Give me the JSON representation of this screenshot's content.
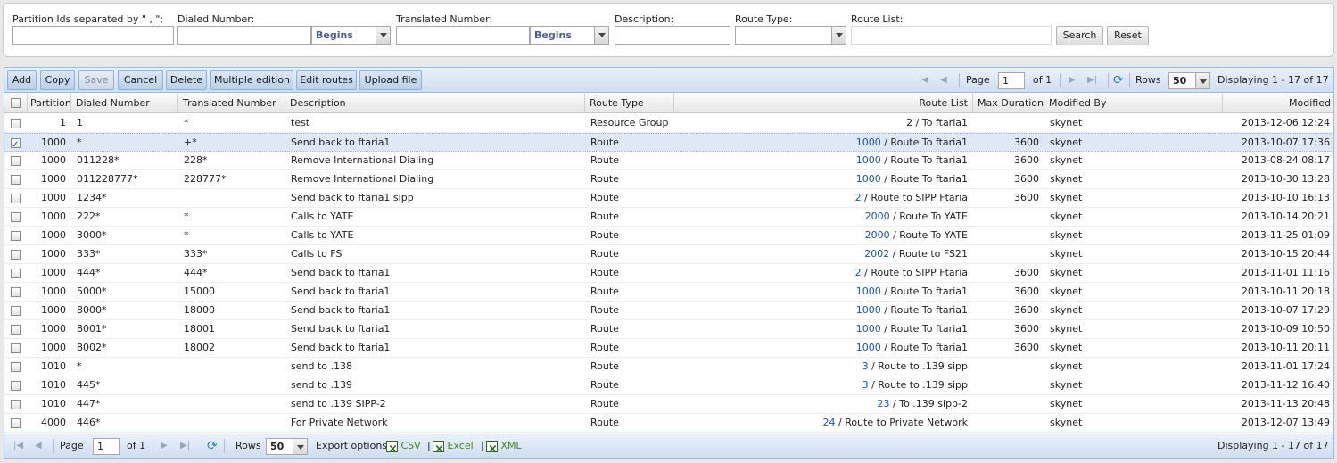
{
  "search": {
    "partition_label": "Partition Ids separated by \" , \":",
    "dialed_label": "Dialed Number:",
    "dialed_mode": "Begins",
    "translated_label": "Translated Number:",
    "translated_mode": "Begins",
    "description_label": "Description:",
    "route_type_label": "Route Type:",
    "route_list_label": "Route List:",
    "search_button": "Search",
    "reset_button": "Reset"
  },
  "toolbar": {
    "add": "Add",
    "copy": "Copy",
    "save": "Save",
    "cancel": "Cancel",
    "delete": "Delete",
    "multiple_edition": "Multiple edition",
    "edit_routes": "Edit routes",
    "upload_file": "Upload file",
    "page_label": "Page",
    "page_value": "1",
    "of_label": "of 1",
    "rows_label": "Rows",
    "rows_value": "50",
    "displaying": "Displaying 1 - 17 of 17"
  },
  "columns": [
    "Partition",
    "Dialed Number",
    "Translated Number",
    "Description",
    "Route Type",
    "Route List",
    "Max Duration",
    "Modified By",
    "Modified"
  ],
  "rows": [
    {
      "checked": false,
      "partition": "1",
      "dialed": "1",
      "translated": "*",
      "description": "test",
      "route_type": "Resource Group",
      "rl_id": "",
      "rl_name": "2 / To ftaria1",
      "max": "",
      "by": "skynet",
      "modified": "2013-12-06 12:24"
    },
    {
      "checked": true,
      "partition": "1000",
      "dialed": "*",
      "translated": "+*",
      "description": "Send back to ftaria1",
      "route_type": "Route",
      "rl_id": "1000",
      "rl_name": " / Route To ftaria1",
      "max": "3600",
      "by": "skynet",
      "modified": "2013-10-07 17:36"
    },
    {
      "checked": false,
      "partition": "1000",
      "dialed": "011228*",
      "translated": "228*",
      "description": "Remove International Dialing",
      "route_type": "Route",
      "rl_id": "1000",
      "rl_name": " / Route To ftaria1",
      "max": "3600",
      "by": "skynet",
      "modified": "2013-08-24 08:17"
    },
    {
      "checked": false,
      "partition": "1000",
      "dialed": "011228777*",
      "translated": "228777*",
      "description": "Remove International Dialing",
      "route_type": "Route",
      "rl_id": "1000",
      "rl_name": " / Route To ftaria1",
      "max": "3600",
      "by": "skynet",
      "modified": "2013-10-30 13:28"
    },
    {
      "checked": false,
      "partition": "1000",
      "dialed": "1234*",
      "translated": "",
      "description": "Send back to ftaria1 sipp",
      "route_type": "Route",
      "rl_id": "2",
      "rl_name": " / Route to SIPP Ftaria",
      "max": "3600",
      "by": "skynet",
      "modified": "2013-10-10 16:13"
    },
    {
      "checked": false,
      "partition": "1000",
      "dialed": "222*",
      "translated": "*",
      "description": "Calls to YATE",
      "route_type": "Route",
      "rl_id": "2000",
      "rl_name": " / Route To YATE",
      "max": "",
      "by": "skynet",
      "modified": "2013-10-14 20:21"
    },
    {
      "checked": false,
      "partition": "1000",
      "dialed": "3000*",
      "translated": "*",
      "description": "Calls to YATE",
      "route_type": "Route",
      "rl_id": "2000",
      "rl_name": " / Route To YATE",
      "max": "",
      "by": "skynet",
      "modified": "2013-11-25 01:09"
    },
    {
      "checked": false,
      "partition": "1000",
      "dialed": "333*",
      "translated": "333*",
      "description": "Calls to FS",
      "route_type": "Route",
      "rl_id": "2002",
      "rl_name": " / Route to FS21",
      "max": "",
      "by": "skynet",
      "modified": "2013-10-15 20:44"
    },
    {
      "checked": false,
      "partition": "1000",
      "dialed": "444*",
      "translated": "444*",
      "description": "Send back to ftaria1",
      "route_type": "Route",
      "rl_id": "2",
      "rl_name": " / Route to SIPP Ftaria",
      "max": "3600",
      "by": "skynet",
      "modified": "2013-11-01 11:16"
    },
    {
      "checked": false,
      "partition": "1000",
      "dialed": "5000*",
      "translated": "15000",
      "description": "Send back to ftaria1",
      "route_type": "Route",
      "rl_id": "1000",
      "rl_name": " / Route To ftaria1",
      "max": "3600",
      "by": "skynet",
      "modified": "2013-10-11 20:18"
    },
    {
      "checked": false,
      "partition": "1000",
      "dialed": "8000*",
      "translated": "18000",
      "description": "Send back to ftaria1",
      "route_type": "Route",
      "rl_id": "1000",
      "rl_name": " / Route To ftaria1",
      "max": "3600",
      "by": "skynet",
      "modified": "2013-10-07 17:29"
    },
    {
      "checked": false,
      "partition": "1000",
      "dialed": "8001*",
      "translated": "18001",
      "description": "Send back to ftaria1",
      "route_type": "Route",
      "rl_id": "1000",
      "rl_name": " / Route To ftaria1",
      "max": "3600",
      "by": "skynet",
      "modified": "2013-10-09 10:50"
    },
    {
      "checked": false,
      "partition": "1000",
      "dialed": "8002*",
      "translated": "18002",
      "description": "Send back to ftaria1",
      "route_type": "Route",
      "rl_id": "1000",
      "rl_name": " / Route To ftaria1",
      "max": "3600",
      "by": "skynet",
      "modified": "2013-10-11 20:11"
    },
    {
      "checked": false,
      "partition": "1010",
      "dialed": "*",
      "translated": "",
      "description": "send to .138",
      "route_type": "Route",
      "rl_id": "3",
      "rl_name": " / Route to .139 sipp",
      "max": "",
      "by": "skynet",
      "modified": "2013-11-01 17:24"
    },
    {
      "checked": false,
      "partition": "1010",
      "dialed": "445*",
      "translated": "",
      "description": "send to .139",
      "route_type": "Route",
      "rl_id": "3",
      "rl_name": " / Route to .139 sipp",
      "max": "",
      "by": "skynet",
      "modified": "2013-11-12 16:40"
    },
    {
      "checked": false,
      "partition": "1010",
      "dialed": "447*",
      "translated": "",
      "description": "send to .139 SIPP-2",
      "route_type": "Route",
      "rl_id": "23",
      "rl_name": " / To .139 sipp-2",
      "max": "",
      "by": "skynet",
      "modified": "2013-11-13 20:48"
    },
    {
      "checked": false,
      "partition": "4000",
      "dialed": "446*",
      "translated": "",
      "description": "For Private Network",
      "route_type": "Route",
      "rl_id": "24",
      "rl_name": " / Route to Private Network",
      "max": "",
      "by": "skynet",
      "modified": "2013-12-07 13:49"
    }
  ],
  "bottom": {
    "page_label": "Page",
    "page_value": "1",
    "of_label": "of 1",
    "rows_label": "Rows",
    "rows_value": "50",
    "export_label": "Export options:",
    "csv": "CSV",
    "excel": "Excel",
    "xml": "XML",
    "sep1": "|",
    "sep2": "|",
    "displaying": "Displaying 1 - 17 of 17"
  }
}
